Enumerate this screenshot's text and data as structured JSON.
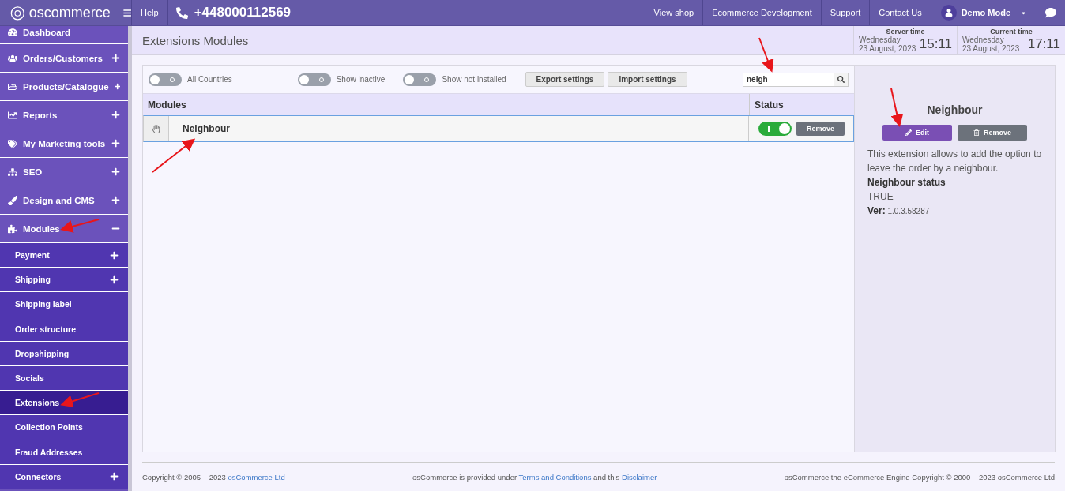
{
  "topbar": {
    "logo": "oscommerce",
    "help": "Help",
    "phone": "+448000112569",
    "links": [
      "View shop",
      "Ecommerce Development",
      "Support",
      "Contact Us"
    ],
    "user": "Demo Mode"
  },
  "sidebar": {
    "items": [
      {
        "label": "Dashboard",
        "kind": "cut",
        "selected": false
      },
      {
        "label": "Orders/Customers",
        "kind": "group",
        "expanded": false,
        "selected": false
      },
      {
        "label": "Products/Catalogue",
        "kind": "group",
        "expanded": false,
        "selected": false
      },
      {
        "label": "Reports",
        "kind": "group",
        "expanded": false,
        "selected": false
      },
      {
        "label": "My Marketing tools",
        "kind": "group",
        "expanded": false,
        "selected": false
      },
      {
        "label": "SEO",
        "kind": "group",
        "expanded": false,
        "selected": false
      },
      {
        "label": "Design and CMS",
        "kind": "group",
        "expanded": false,
        "selected": false
      },
      {
        "label": "Modules",
        "kind": "group",
        "expanded": true,
        "selected": false,
        "children": [
          {
            "label": "Payment",
            "kind": "subgroup",
            "expanded": false,
            "selected": false
          },
          {
            "label": "Shipping",
            "kind": "subgroup",
            "expanded": false,
            "selected": false
          },
          {
            "label": "Shipping label",
            "kind": "sub",
            "selected": false
          },
          {
            "label": "Order structure",
            "kind": "sub",
            "selected": false
          },
          {
            "label": "Dropshipping",
            "kind": "sub",
            "selected": false
          },
          {
            "label": "Socials",
            "kind": "sub",
            "selected": false
          },
          {
            "label": "Extensions",
            "kind": "sub",
            "selected": true
          },
          {
            "label": "Collection Points",
            "kind": "sub",
            "selected": false
          },
          {
            "label": "Fraud Addresses",
            "kind": "sub",
            "selected": false
          },
          {
            "label": "Connectors",
            "kind": "subgroup",
            "expanded": false,
            "selected": false
          }
        ]
      }
    ]
  },
  "page": {
    "title": "Extensions Modules",
    "clocks": [
      {
        "label": "Server time",
        "day": "Wednesday",
        "date": "23 August, 2023",
        "time": "15:11"
      },
      {
        "label": "Current time",
        "day": "Wednesday",
        "date": "23 August, 2023",
        "time": "17:11"
      }
    ]
  },
  "filters": {
    "toggles": [
      {
        "label": "All Countries",
        "on": false
      },
      {
        "label": "Show inactive",
        "on": false
      },
      {
        "label": "Show not installed",
        "on": false
      }
    ],
    "buttons": [
      "Export settings",
      "Import settings"
    ],
    "search": {
      "value": "neigh"
    }
  },
  "table": {
    "columns": [
      "Modules",
      "Status"
    ],
    "rows": [
      {
        "name": "Neighbour",
        "enabled": true,
        "remove": "Remove",
        "selected": true
      }
    ]
  },
  "details": {
    "title": "Neighbour",
    "edit": "Edit",
    "remove": "Remove",
    "description": "This extension allows to add the option to leave the order by a neighbour.",
    "status_label": "Neighbour status",
    "status_value": "TRUE",
    "version_label": "Ver:",
    "version": "1.0.3.58287"
  },
  "footer": {
    "left": "Copyright © 2005 – 2023 ",
    "left_link": "osCommerce Ltd",
    "middle": "osCommerce is provided under ",
    "terms": "Terms and Conditions",
    "middle2": " and this ",
    "disclaimer": "Disclaimer",
    "right": "osCommerce the eCommerce Engine Copyright © 2000 – 2023 osCommerce Ltd"
  }
}
